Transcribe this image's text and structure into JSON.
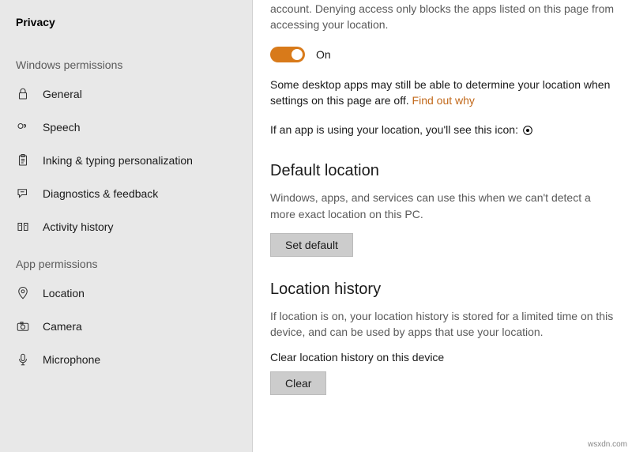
{
  "sidebar": {
    "title": "Privacy",
    "sections": {
      "windows": {
        "header": "Windows permissions",
        "items": [
          {
            "label": "General"
          },
          {
            "label": "Speech"
          },
          {
            "label": "Inking & typing personalization"
          },
          {
            "label": "Diagnostics & feedback"
          },
          {
            "label": "Activity history"
          }
        ]
      },
      "app": {
        "header": "App permissions",
        "items": [
          {
            "label": "Location"
          },
          {
            "label": "Camera"
          },
          {
            "label": "Microphone"
          }
        ]
      }
    }
  },
  "main": {
    "top_desc": "account. Denying access only blocks the apps listed on this page from accessing your location.",
    "toggle": {
      "state": "On"
    },
    "desktop_apps_text": "Some desktop apps may still be able to determine your location when settings on this page are off. ",
    "find_out_why": "Find out why",
    "app_using_text": "If an app is using your location, you'll see this icon: ",
    "default_location": {
      "title": "Default location",
      "desc": "Windows, apps, and services can use this when we can't detect a more exact location on this PC.",
      "button": "Set default"
    },
    "location_history": {
      "title": "Location history",
      "desc": "If location is on, your location history is stored for a limited time on this device, and can be used by apps that use your location.",
      "clear_label": "Clear location history on this device",
      "button": "Clear"
    }
  },
  "watermark": "wsxdn.com"
}
